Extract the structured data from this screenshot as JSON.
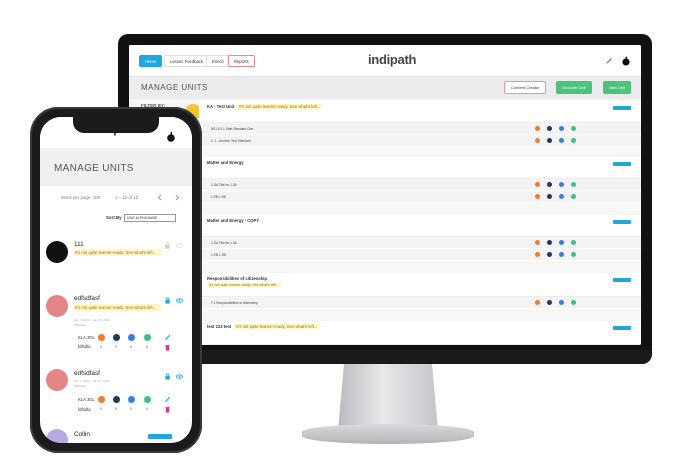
{
  "desktop": {
    "nav": {
      "home": "Home",
      "lesson_feedback": "Lesson Feedback",
      "enrich": "Enrich",
      "reports": "Reports"
    },
    "logo": "indipath",
    "header_title": "MANAGE UNITS",
    "buttons": {
      "content_creator": "Content Creator",
      "discover_unit": "Discover Unit",
      "new_unit": "New Unit"
    },
    "filter_label": "FILTER BY:",
    "warning_text": "It's not quite learner-ready. See what's left...",
    "units": [
      {
        "title": "KA - Test Unit",
        "standards": [
          "NS LR1.1 Start Standard One",
          "V. 1 - Another Test Standard"
        ]
      },
      {
        "title": "Matter and Energy",
        "standards": [
          "1-SA Title for 1.3A",
          "1.SB 1.SB"
        ]
      },
      {
        "title": "Matter and Energy - COPY",
        "standards": [
          "1-SA Title for 1.3A",
          "1.SB 1.SB"
        ]
      },
      {
        "title": "Responsibilities of citizenship",
        "standards": [
          "7.1 Responsibilities of citizenship"
        ]
      },
      {
        "title": "test 123 test"
      }
    ],
    "colors": {
      "accent": "#1ea7e0",
      "green": "#4cc37a"
    }
  },
  "mobile": {
    "logo": "indipath",
    "title": "MANAGE UNITS",
    "items_per_page_label": "Items per page: 100",
    "page_range": "1 – 12 of 12",
    "sort_by_label": "Sort By",
    "sort_value": "UNIT ALPHA NAME",
    "warning_text": "It's not quite learner-ready. See what's left...",
    "units": [
      {
        "name": "111"
      },
      {
        "name": "edfsdfasf",
        "date": "Jan 1, 2021 - Jan 15, 2021",
        "code": "fdfDsdfa",
        "standard_label": "KLA.301.",
        "standard_sub": "fdfsdfa",
        "counts": [
          "0",
          "0",
          "0",
          "0"
        ]
      },
      {
        "name": "edfsdfasf",
        "date": "Jan 1, 2021 - Jan 15, 2021",
        "code": "fdfDsdfa",
        "standard_label": "KLA.301.",
        "standard_sub": "fdfsdfa",
        "counts": [
          "0",
          "0",
          "0",
          "0"
        ]
      },
      {
        "name": "Collin"
      }
    ]
  }
}
